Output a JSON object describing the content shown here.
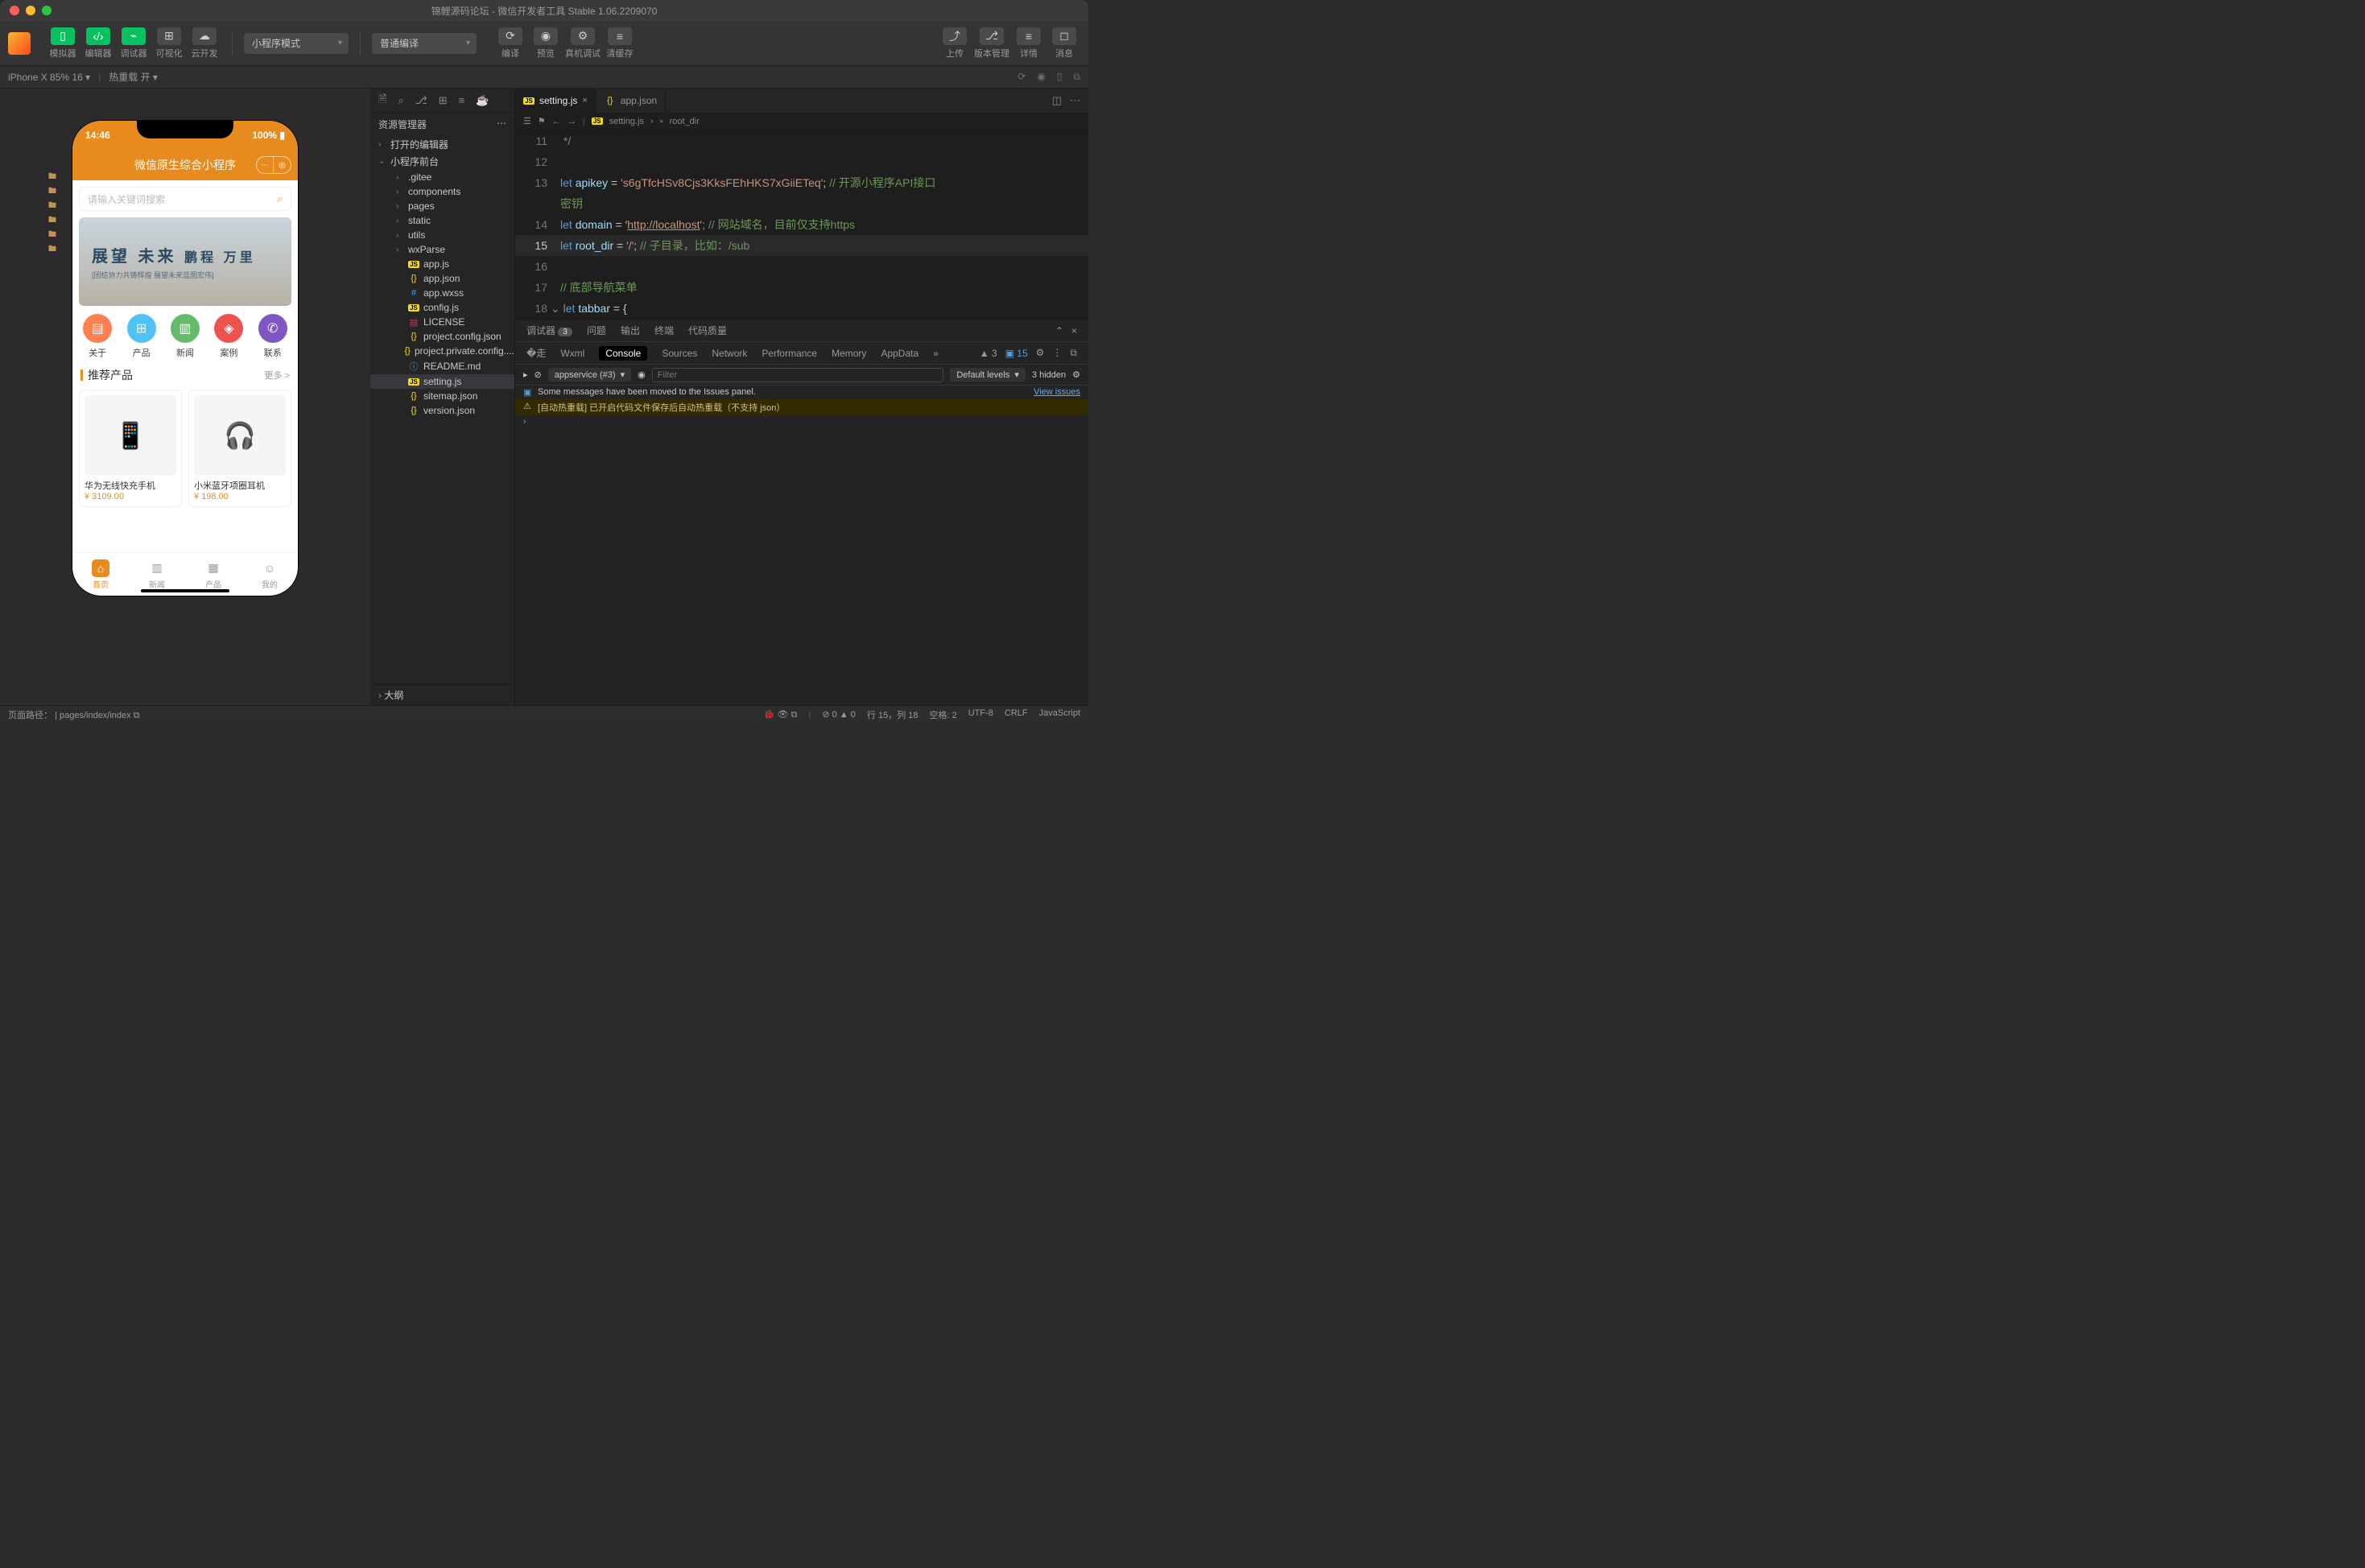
{
  "window": {
    "title": "锦鲤源码论坛 - 微信开发者工具 Stable 1.06.2209070"
  },
  "toolbar": {
    "simulator": "模拟器",
    "editor": "编辑器",
    "debugger": "调试器",
    "visual": "可视化",
    "cloud": "云开发",
    "mode": "小程序模式",
    "compile_mode": "普通编译",
    "compile": "编译",
    "preview": "预览",
    "realdbg": "真机调试",
    "clearcache": "清缓存",
    "upload": "上传",
    "version": "版本管理",
    "detail": "详情",
    "msg": "消息"
  },
  "subbar": {
    "device": "iPhone X 85% 16",
    "hotreload": "热重载 开"
  },
  "explorer": {
    "title": "资源管理器",
    "open_editors": "打开的编辑器",
    "root": "小程序前台",
    "items": [
      {
        "t": "folder",
        "n": ".gitee"
      },
      {
        "t": "folder",
        "n": "components"
      },
      {
        "t": "folder",
        "n": "pages"
      },
      {
        "t": "folder",
        "n": "static"
      },
      {
        "t": "folder",
        "n": "utils"
      },
      {
        "t": "folder",
        "n": "wxParse"
      },
      {
        "t": "js",
        "n": "app.js"
      },
      {
        "t": "json",
        "n": "app.json"
      },
      {
        "t": "css",
        "n": "app.wxss"
      },
      {
        "t": "js",
        "n": "config.js"
      },
      {
        "t": "lic",
        "n": "LICENSE"
      },
      {
        "t": "json",
        "n": "project.config.json"
      },
      {
        "t": "json",
        "n": "project.private.config...."
      },
      {
        "t": "md",
        "n": "README.md"
      },
      {
        "t": "js",
        "n": "setting.js",
        "sel": true
      },
      {
        "t": "json",
        "n": "sitemap.json"
      },
      {
        "t": "json",
        "n": "version.json"
      }
    ],
    "outline": "大纲"
  },
  "tabs": {
    "t1": "setting.js",
    "t2": "app.json"
  },
  "breadcrumb": {
    "file": "setting.js",
    "sym": "root_dir"
  },
  "code": {
    "l11": " */",
    "l13_pre": "let ",
    "l13_var": "apikey",
    "l13_eq": " = ",
    "l13_str": "'s6gTfcHSv8Cjs3KksFEhHKS7xGiiETeq'",
    "l13_end": "; ",
    "l13_c": "// 开源小程序API接口",
    "l13b": "密钥",
    "l14_pre": "let ",
    "l14_var": "domain",
    "l14_eq": " = '",
    "l14_url": "http://localhost",
    "l14_end": "'; ",
    "l14_c": "// 网站域名，目前仅支持https",
    "l15_pre": "let ",
    "l15_var": "root_dir",
    "l15_eq": " = ",
    "l15_str": "'/'",
    "l15_end": "; ",
    "l15_c": "// 子目录，比如：/sub",
    "l17_c": "// 底部导航菜单",
    "l18_pre": "let ",
    "l18_var": "tabbar",
    "l18_end": " = {"
  },
  "devtools": {
    "tabs": {
      "dbg": "调试器",
      "cnt": "3",
      "issues": "问题",
      "output": "输出",
      "terminal": "终端",
      "quality": "代码质量"
    },
    "sub": {
      "wxml": "Wxml",
      "console": "Console",
      "sources": "Sources",
      "network": "Network",
      "performance": "Performance",
      "memory": "Memory",
      "appdata": "AppData"
    },
    "ctx": "appservice (#3)",
    "filter_ph": "Filter",
    "levels": "Default levels",
    "hidden": "3 hidden",
    "warn_a": "▲ 3",
    "warn_b": "▣ 15",
    "log1": "Some messages have been moved to the Issues panel.",
    "log1_link": "View issues",
    "log2": "[自动热重载] 已开启代码文件保存后自动热重载（不支持 json）"
  },
  "status": {
    "path_lbl": "页面路径：",
    "path": "pages/index/index",
    "err": "0",
    "warn": "0",
    "pos": "行 15，列 18",
    "spaces": "空格: 2",
    "enc": "UTF-8",
    "eol": "CRLF",
    "lang": "JavaScript"
  },
  "sim": {
    "time": "14:46",
    "battery": "100%",
    "title": "微信原生综合小程序",
    "search_ph": "请输入关键词搜索",
    "banner1": "展望 未来",
    "banner2": "鹏程 万里",
    "banner3": "[团结协力共铸辉煌  展望未来蓝图宏伟]",
    "icons": [
      {
        "l": "关于",
        "bg": "#ff7f50",
        "g": "▤"
      },
      {
        "l": "产品",
        "bg": "#4fc3f7",
        "g": "⊞"
      },
      {
        "l": "新闻",
        "bg": "#66bb6a",
        "g": "▥"
      },
      {
        "l": "案例",
        "bg": "#ef5350",
        "g": "◈"
      },
      {
        "l": "联系",
        "bg": "#7e57c2",
        "g": "✆"
      }
    ],
    "sect": "推荐产品",
    "more": "更多 >",
    "prods": [
      {
        "n": "华为无线快充手机",
        "p": "¥ 3109.00",
        "e": "📱"
      },
      {
        "n": "小米蓝牙项圈耳机",
        "p": "¥ 198.00",
        "e": "🎧"
      }
    ],
    "tabs": [
      {
        "l": "首页",
        "active": true,
        "g": "⌂"
      },
      {
        "l": "新闻",
        "g": "▥"
      },
      {
        "l": "产品",
        "g": "▦"
      },
      {
        "l": "我的",
        "g": "☺"
      }
    ]
  }
}
